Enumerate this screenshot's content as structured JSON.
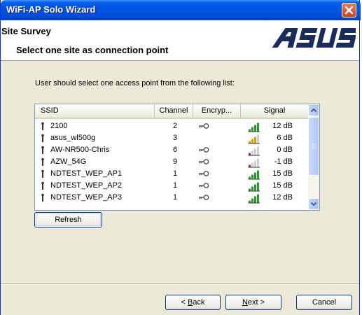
{
  "window": {
    "title": "WiFi-AP Solo Wizard"
  },
  "header": {
    "section_title": "Site Survey",
    "subtitle": "Select one site as connection point",
    "logo_text": "ASUS"
  },
  "instruction": "User should select one access point from the following list:",
  "columns": {
    "ssid": "SSID",
    "channel": "Channel",
    "encryption": "Encryp...",
    "signal": "Signal"
  },
  "access_points": [
    {
      "ssid": "2100",
      "channel": "2",
      "encrypted": true,
      "signal": "12 dB",
      "bars": 5
    },
    {
      "ssid": "asus_wl500g",
      "channel": "3",
      "encrypted": false,
      "signal": "6 dB",
      "bars": 3
    },
    {
      "ssid": "AW-NR500-Chris",
      "channel": "6",
      "encrypted": true,
      "signal": "0 dB",
      "bars": 1
    },
    {
      "ssid": "AZW_54G",
      "channel": "9",
      "encrypted": true,
      "signal": "-1 dB",
      "bars": 1
    },
    {
      "ssid": "NDTEST_WEP_AP1",
      "channel": "1",
      "encrypted": true,
      "signal": "15 dB",
      "bars": 5
    },
    {
      "ssid": "NDTEST_WEP_AP2",
      "channel": "1",
      "encrypted": true,
      "signal": "15 dB",
      "bars": 5
    },
    {
      "ssid": "NDTEST_WEP_AP3",
      "channel": "1",
      "encrypted": true,
      "signal": "12 dB",
      "bars": 5
    }
  ],
  "buttons": {
    "refresh": "Refresh",
    "back_prefix": "< ",
    "back_key": "B",
    "back_rest": "ack",
    "next_key": "N",
    "next_rest": "ext >",
    "cancel": "Cancel"
  },
  "colors": {
    "title_bar": "#0054e3",
    "dialog_bg": "#ece9d8",
    "signal_high": "#2a9a2a",
    "signal_mid": "#d4a400",
    "signal_low": "#c8221c"
  }
}
